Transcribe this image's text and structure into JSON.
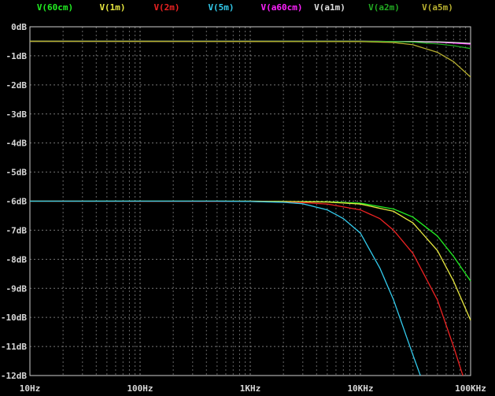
{
  "window": {
    "title": ""
  },
  "chart_data": {
    "type": "line",
    "title": "",
    "xlabel": "",
    "ylabel": "",
    "x_scale": "log",
    "xlim": [
      10,
      100000
    ],
    "ylim": [
      -12,
      0
    ],
    "grid": true,
    "grid_color": "#8a8a8a",
    "axis_color": "#cfcfcf",
    "background": "#000000",
    "legend_placement": "top",
    "x_ticks": [
      {
        "value": 10,
        "label": "10Hz"
      },
      {
        "value": 100,
        "label": "100Hz"
      },
      {
        "value": 1000,
        "label": "1KHz"
      },
      {
        "value": 10000,
        "label": "10KHz"
      },
      {
        "value": 100000,
        "label": "100KHz"
      }
    ],
    "y_ticks": [
      {
        "value": 0,
        "label": "0dB"
      },
      {
        "value": -1,
        "label": "-1dB"
      },
      {
        "value": -2,
        "label": "-2dB"
      },
      {
        "value": -3,
        "label": "-3dB"
      },
      {
        "value": -4,
        "label": "-4dB"
      },
      {
        "value": -5,
        "label": "-5dB"
      },
      {
        "value": -6,
        "label": "-6dB"
      },
      {
        "value": -7,
        "label": "-7dB"
      },
      {
        "value": -8,
        "label": "-8dB"
      },
      {
        "value": -9,
        "label": "-9dB"
      },
      {
        "value": -10,
        "label": "-10dB"
      },
      {
        "value": -11,
        "label": "-11dB"
      },
      {
        "value": -12,
        "label": "-12dB"
      }
    ],
    "series": [
      {
        "name": "V(60cm)",
        "color": "#22ee22",
        "x": [
          10,
          1000,
          5000,
          10000,
          20000,
          30000,
          50000,
          70000,
          100000
        ],
        "y": [
          -6,
          -6,
          -6.02,
          -6.07,
          -6.27,
          -6.55,
          -7.2,
          -7.9,
          -8.75
        ]
      },
      {
        "name": "V(1m)",
        "color": "#e8e840",
        "x": [
          10,
          1000,
          5000,
          10000,
          20000,
          30000,
          50000,
          70000,
          100000
        ],
        "y": [
          -6,
          -6,
          -6.03,
          -6.1,
          -6.35,
          -6.75,
          -7.7,
          -8.75,
          -10.1
        ]
      },
      {
        "name": "V(2m)",
        "color": "#ee2222",
        "x": [
          10,
          1000,
          3000,
          5000,
          10000,
          15000,
          20000,
          30000,
          50000,
          70000,
          85000
        ],
        "y": [
          -6,
          -6.01,
          -6.05,
          -6.1,
          -6.3,
          -6.6,
          -7.0,
          -7.8,
          -9.4,
          -11.0,
          -12.0
        ]
      },
      {
        "name": "V(5m)",
        "color": "#33ccee",
        "x": [
          10,
          500,
          1000,
          2000,
          3000,
          5000,
          7000,
          10000,
          15000,
          20000,
          30000,
          35000
        ],
        "y": [
          -6,
          -6,
          -6.01,
          -6.04,
          -6.09,
          -6.3,
          -6.6,
          -7.1,
          -8.3,
          -9.4,
          -11.3,
          -12.0
        ]
      },
      {
        "name": "V(a60cm)",
        "color": "#ff22ff",
        "x": [
          10,
          10000,
          30000,
          50000,
          70000,
          100000
        ],
        "y": [
          -0.5,
          -0.5,
          -0.51,
          -0.53,
          -0.56,
          -0.6
        ]
      },
      {
        "name": "V(a1m)",
        "color": "#e0e0e0",
        "x": [
          10,
          10000,
          30000,
          50000,
          70000,
          100000
        ],
        "y": [
          -0.5,
          -0.5,
          -0.51,
          -0.52,
          -0.54,
          -0.57
        ]
      },
      {
        "name": "V(a2m)",
        "color": "#22aa22",
        "x": [
          10,
          10000,
          20000,
          30000,
          50000,
          70000,
          100000
        ],
        "y": [
          -0.5,
          -0.5,
          -0.51,
          -0.53,
          -0.59,
          -0.65,
          -0.75
        ]
      },
      {
        "name": "V(a5m)",
        "color": "#b8b030",
        "x": [
          10,
          10000,
          20000,
          30000,
          50000,
          70000,
          100000
        ],
        "y": [
          -0.5,
          -0.51,
          -0.54,
          -0.62,
          -0.88,
          -1.2,
          -1.73
        ]
      }
    ]
  }
}
